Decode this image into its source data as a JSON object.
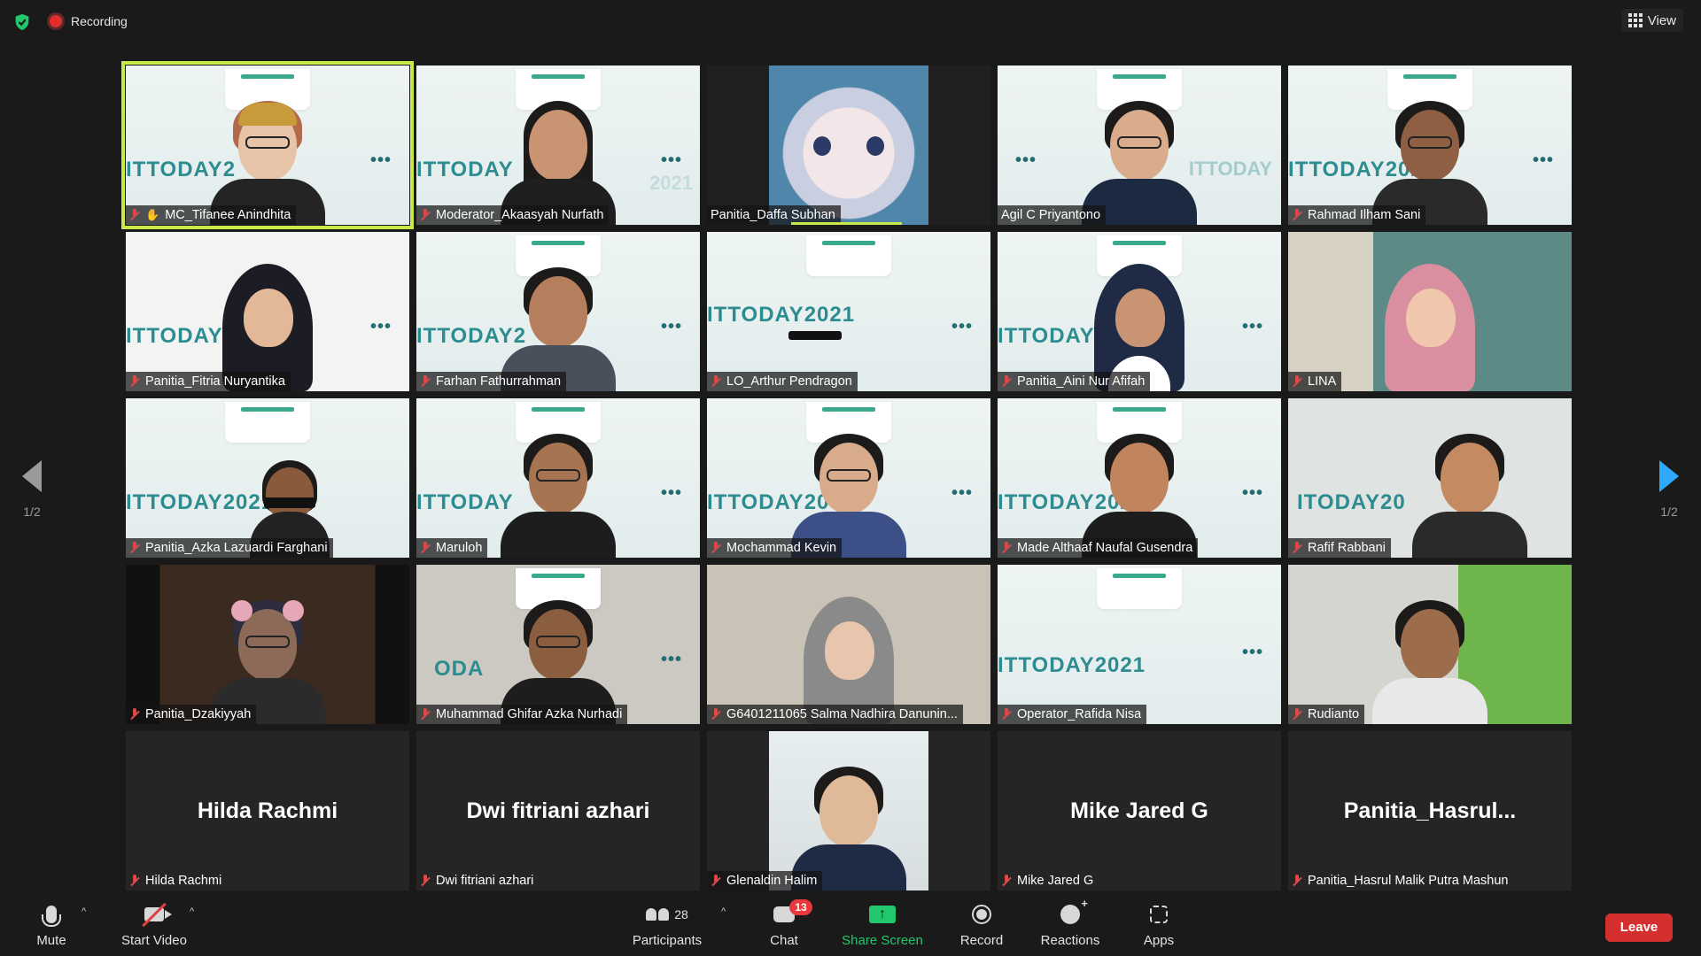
{
  "topbar": {
    "recording_label": "Recording",
    "view_label": "View"
  },
  "pager": {
    "left": "1/2",
    "right": "1/2"
  },
  "tiles": [
    {
      "name": "MC_Tifanee Anindhita",
      "hand_raised": true
    },
    {
      "name": "Moderator_Akaasyah Nurfath"
    },
    {
      "name": "Panitia_Daffa Subhan"
    },
    {
      "name": "Agil C Priyantono"
    },
    {
      "name": "Rahmad Ilham Sani"
    },
    {
      "name": "Panitia_Fitria Nuryantika"
    },
    {
      "name": "Farhan Fathurrahman"
    },
    {
      "name": "LO_Arthur Pendragon"
    },
    {
      "name": "Panitia_Aini Nur Afifah"
    },
    {
      "name": "LINA"
    },
    {
      "name": "Panitia_Azka Lazuardi Farghani"
    },
    {
      "name": "Maruloh"
    },
    {
      "name": "Mochammad Kevin"
    },
    {
      "name": "Made Althaaf Naufal Gusendra"
    },
    {
      "name": "Rafif Rabbani"
    },
    {
      "name": "Panitia_Dzakiyyah"
    },
    {
      "name": "Muhammad Ghifar Azka Nurhadi"
    },
    {
      "name": "G6401211065 Salma Nadhira Danunin..."
    },
    {
      "name": "Operator_Rafida Nisa"
    },
    {
      "name": "Rudianto"
    },
    {
      "name": "Hilda Rachmi",
      "display": "Hilda Rachmi"
    },
    {
      "name": "Dwi fitriani azhari",
      "display": "Dwi fitriani azhari"
    },
    {
      "name": "Glenaldin Halim"
    },
    {
      "name": "Mike Jared G",
      "display": "Mike Jared G"
    },
    {
      "name": "Panitia_Hasrul Malik Putra Mashun",
      "display": "Panitia_Hasrul..."
    }
  ],
  "brand": {
    "text": "ITTODAY2021",
    "short1": "ITTODAY2",
    "short2": "ITTODAY",
    "short3": "ITTODAY20",
    "short4": "ITTODAY202",
    "short5": "ITODAY20",
    "short6": "ODA",
    "ghost1": "ITTODAY",
    "ghost2": "2021"
  },
  "toolbar": {
    "mute": "Mute",
    "start_video": "Start Video",
    "participants": "Participants",
    "participants_count": "28",
    "chat": "Chat",
    "chat_badge": "13",
    "share_screen": "Share Screen",
    "record": "Record",
    "reactions": "Reactions",
    "apps": "Apps",
    "leave": "Leave"
  },
  "colors": {
    "speaker_outline": "#c9e84a",
    "share_green": "#23c76b",
    "leave_red": "#d32f2f",
    "next_arrow": "#2fa8ff"
  }
}
